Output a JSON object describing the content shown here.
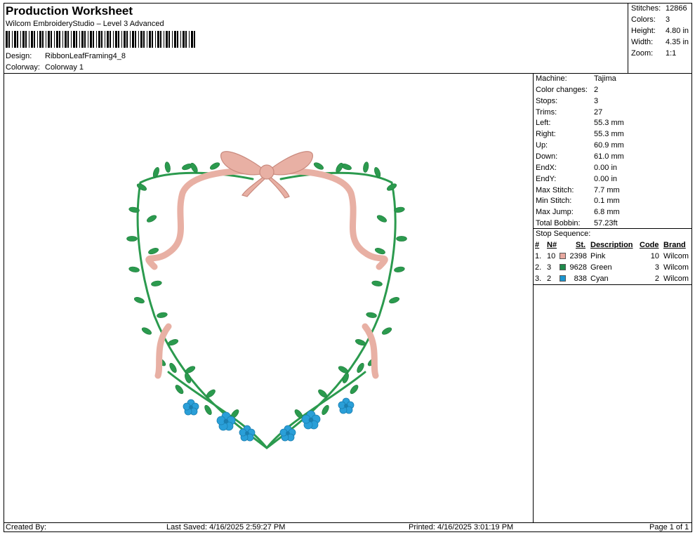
{
  "header": {
    "title": "Production Worksheet",
    "subtitle": "Wilcom EmbroideryStudio – Level 3 Advanced",
    "design_label": "Design:",
    "design_value": "RibbonLeafFraming4_8",
    "colorway_label": "Colorway:",
    "colorway_value": "Colorway 1"
  },
  "stats": [
    {
      "label": "Stitches:",
      "value": "12866"
    },
    {
      "label": "Colors:",
      "value": "3"
    },
    {
      "label": "Height:",
      "value": "4.80 in"
    },
    {
      "label": "Width:",
      "value": "4.35 in"
    },
    {
      "label": "Zoom:",
      "value": "1:1"
    }
  ],
  "machine_info": [
    {
      "label": "Machine:",
      "value": "Tajima"
    },
    {
      "label": "Color changes:",
      "value": "2"
    },
    {
      "label": "Stops:",
      "value": "3"
    },
    {
      "label": "Trims:",
      "value": "27"
    },
    {
      "label": "Left:",
      "value": "55.3 mm"
    },
    {
      "label": "Right:",
      "value": "55.3 mm"
    },
    {
      "label": "Up:",
      "value": "60.9 mm"
    },
    {
      "label": "Down:",
      "value": "61.0 mm"
    },
    {
      "label": "EndX:",
      "value": "0.00 in"
    },
    {
      "label": "EndY:",
      "value": "0.00 in"
    },
    {
      "label": "Max Stitch:",
      "value": "7.7 mm"
    },
    {
      "label": "Min Stitch:",
      "value": "0.1 mm"
    },
    {
      "label": "Max Jump:",
      "value": "6.8 mm"
    },
    {
      "label": "Total Bobbin:",
      "value": "57.23ft"
    }
  ],
  "stop_sequence": {
    "title": "Stop Sequence:",
    "headers": {
      "num": "#",
      "n": "N#",
      "st": "St.",
      "description": "Description",
      "code": "Code",
      "brand": "Brand"
    },
    "rows": [
      {
        "num": "1.",
        "n": "10",
        "color": "#e8a9a0",
        "st": "2398",
        "description": "Pink",
        "code": "10",
        "brand": "Wilcom"
      },
      {
        "num": "2.",
        "n": "3",
        "color": "#1e8a4a",
        "st": "9628",
        "description": "Green",
        "code": "3",
        "brand": "Wilcom"
      },
      {
        "num": "3.",
        "n": "2",
        "color": "#1b95d0",
        "st": "838",
        "description": "Cyan",
        "code": "2",
        "brand": "Wilcom"
      }
    ]
  },
  "footer": {
    "created_by": "Created By:",
    "last_saved": "Last Saved: 4/16/2025 2:59:27 PM",
    "printed": "Printed: 4/16/2025 3:01:19 PM",
    "page": "Page 1 of 1"
  },
  "design_colors": {
    "ribbon": "#e8b0a4",
    "leaf": "#2b9a4e",
    "flower": "#2a9fd8"
  }
}
